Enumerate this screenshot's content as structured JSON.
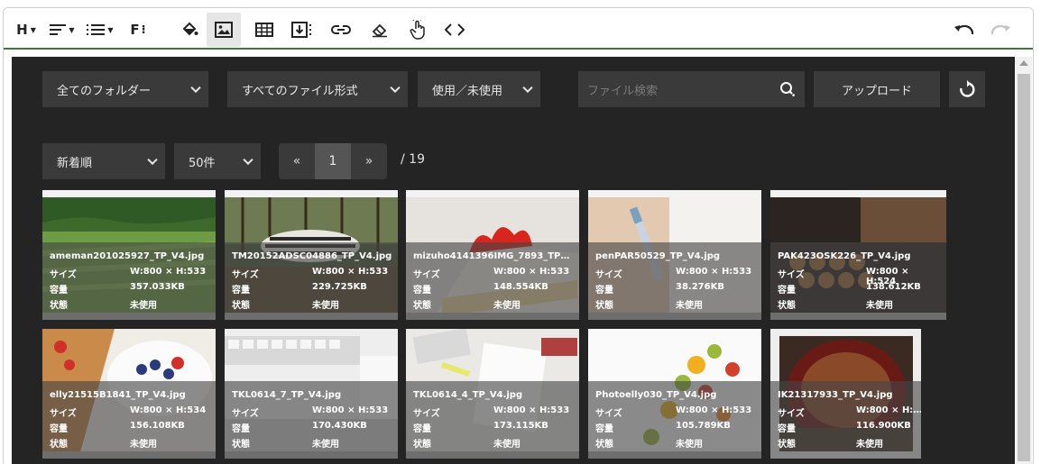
{
  "toolbar": {
    "heading_label": "H",
    "font_label": "F"
  },
  "filters": {
    "folder": "全てのフォルダー",
    "file_type": "すべてのファイル形式",
    "usage": "使用／未使用",
    "search_placeholder": "ファイル検索",
    "upload_label": "アップロード",
    "sort": "新着順",
    "per_page": "50件"
  },
  "pagination": {
    "prev": "«",
    "current": "1",
    "next": "»",
    "total": "/ 19"
  },
  "labels": {
    "size": "サイズ",
    "capacity": "容量",
    "status": "状態"
  },
  "images": [
    {
      "name": "ameman201025927_TP_V4.jpg",
      "size": "W:800 × H:533",
      "capacity": "357.033KB",
      "status": "未使用"
    },
    {
      "name": "TM20152ADSC04886_TP_V4.jpg",
      "size": "W:800 × H:533",
      "capacity": "229.725KB",
      "status": "未使用"
    },
    {
      "name": "mizuho4141396IMG_7893_TP…",
      "size": "W:800 × H:533",
      "capacity": "148.554KB",
      "status": "未使用"
    },
    {
      "name": "penPAR50529_TP_V4.jpg",
      "size": "W:800 × H:533",
      "capacity": "38.276KB",
      "status": "未使用"
    },
    {
      "name": "PAK423OSK226_TP_V4.jpg",
      "size": "W:800 × H:524",
      "capacity": "138.612KB",
      "status": "未使用"
    },
    {
      "name": "elly21515B1841_TP_V4.jpg",
      "size": "W:800 × H:534",
      "capacity": "156.108KB",
      "status": "未使用"
    },
    {
      "name": "TKL0614_7_TP_V4.jpg",
      "size": "W:800 × H:533",
      "capacity": "170.430KB",
      "status": "未使用"
    },
    {
      "name": "TKL0614_4_TP_V4.jpg",
      "size": "W:800 × H:533",
      "capacity": "173.115KB",
      "status": "未使用"
    },
    {
      "name": "Photoelly030_TP_V4.jpg",
      "size": "W:800 × H:533",
      "capacity": "105.789KB",
      "status": "未使用"
    },
    {
      "name": "IK21317933_TP_V4.jpg",
      "size": "W:800 × H:…",
      "capacity": "116.900KB",
      "status": "未使用"
    }
  ],
  "colors": {
    "panel_bg": "#242424",
    "control_bg": "#3a3a3a",
    "toolbar_underline": "#3c7a3c"
  }
}
